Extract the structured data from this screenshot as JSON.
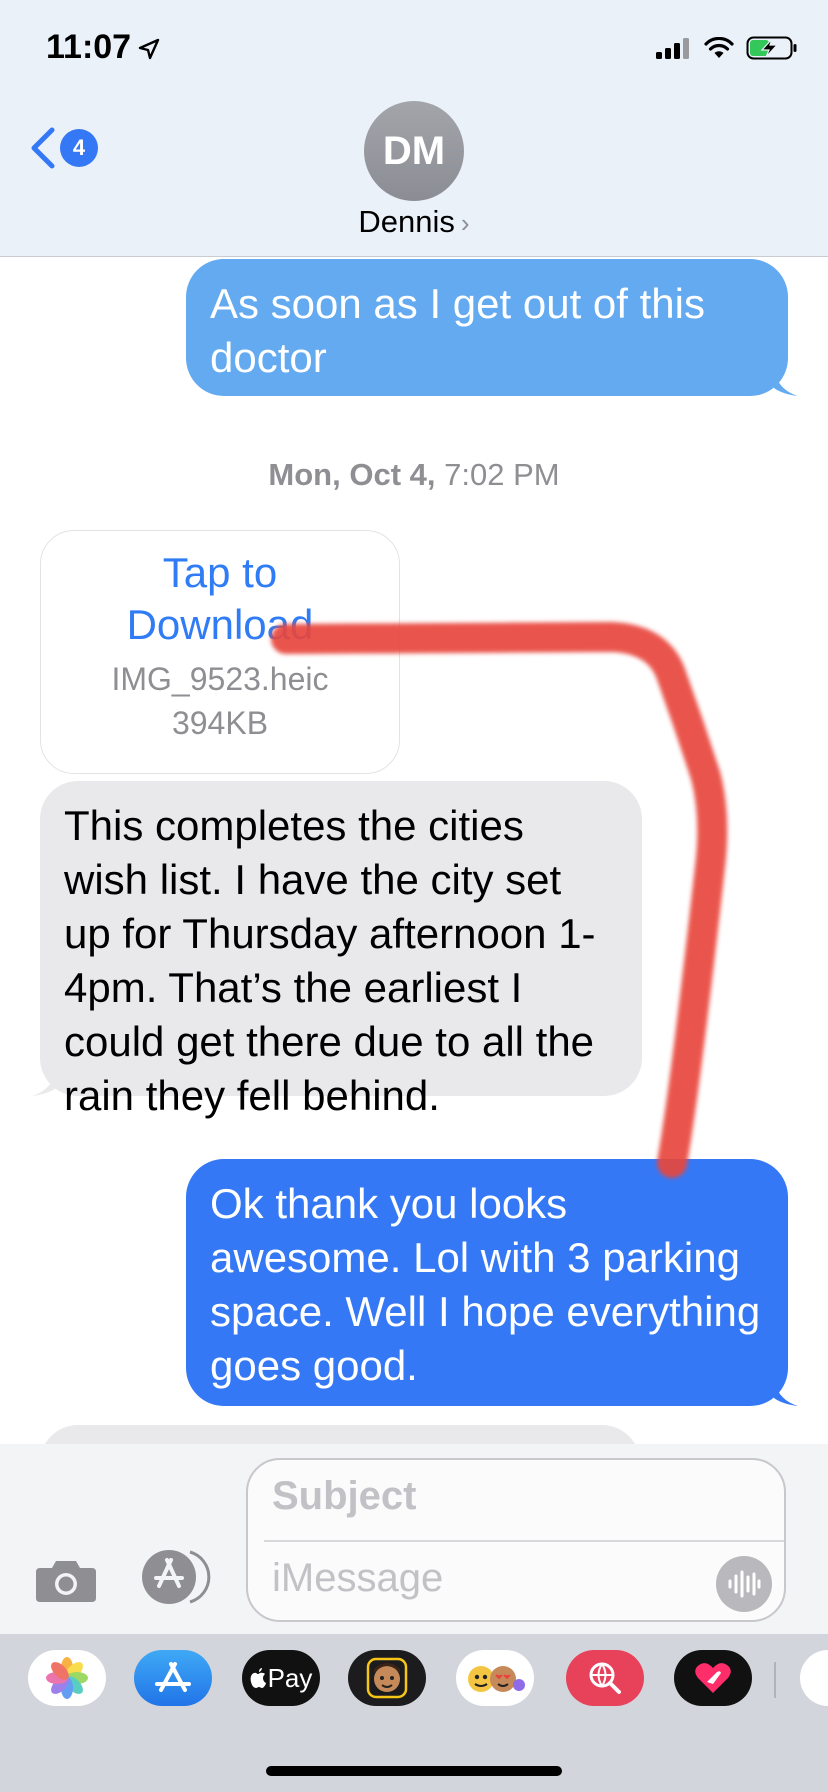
{
  "status_bar": {
    "time": "11:07",
    "icons": [
      "location-arrow-icon",
      "cellular-signal-icon",
      "wifi-icon",
      "battery-charging-icon"
    ],
    "battery_color": "#34c759"
  },
  "nav": {
    "back_badge": "4",
    "avatar_initials": "DM",
    "contact_name": "Dennis",
    "contact_chevron": "›"
  },
  "messages": [
    {
      "direction": "sent",
      "text": "As soon as I get out of this doctor"
    },
    {
      "type": "timestamp",
      "day": "Mon, Oct 4,",
      "time": "7:02 PM"
    },
    {
      "direction": "received",
      "type": "attachment",
      "title": "Tap to Download",
      "filename": "IMG_9523.heic",
      "size": "394KB"
    },
    {
      "direction": "received",
      "text": "This completes the cities wish list. I have the city set up for Thursday afternoon 1-4pm. That’s the earliest I could get there due to all the rain they fell behind."
    },
    {
      "direction": "sent",
      "text": "Ok thank you looks awesome. Lol with 3 parking space.  Well I hope everything goes good."
    },
    {
      "direction": "received",
      "text": ""
    }
  ],
  "composer": {
    "subject_placeholder": "Subject",
    "message_placeholder": "iMessage"
  },
  "app_drawer": {
    "apps": [
      {
        "name": "photos-app-icon"
      },
      {
        "name": "app-store-icon"
      },
      {
        "name": "apple-pay-icon",
        "label": "Pay"
      },
      {
        "name": "memoji-stickers-icon"
      },
      {
        "name": "animoji-icon"
      },
      {
        "name": "web-images-search-icon"
      },
      {
        "name": "digital-touch-icon"
      }
    ]
  },
  "colors": {
    "sent_bubble": "#3478f6",
    "sent_bubble_light": "#63aaf1",
    "received_bubble": "#e9e9eb",
    "annotation_scribble": "#e8463c"
  }
}
